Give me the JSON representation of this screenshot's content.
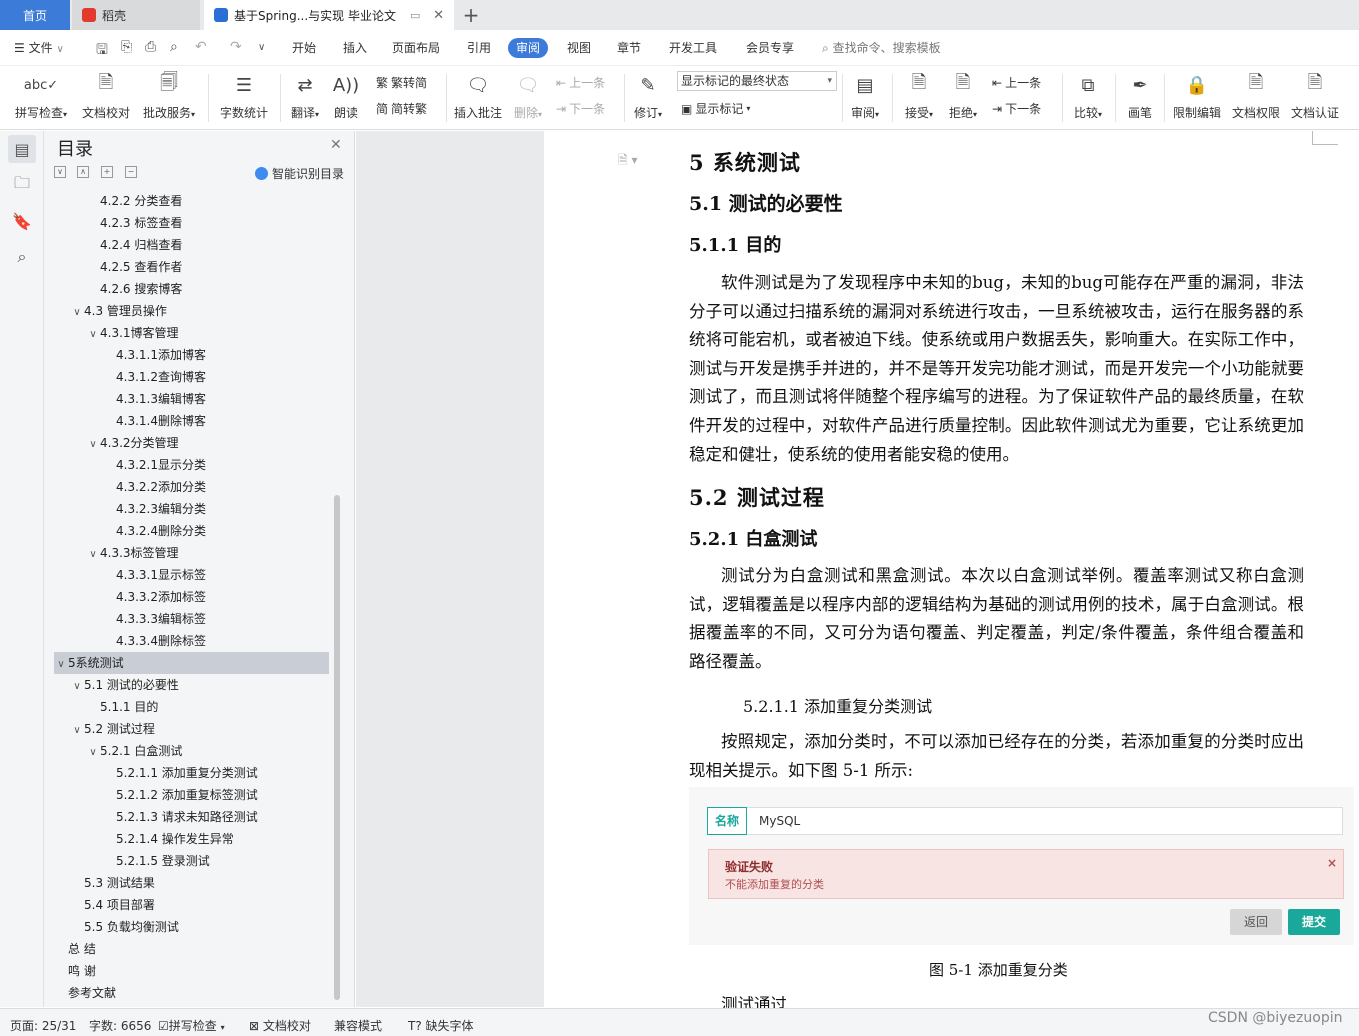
{
  "window": {
    "tabs": {
      "home": "首页",
      "daoke": "稻壳",
      "doc": "基于Spring...与实现 毕业论文"
    }
  },
  "menu": {
    "file": "文件",
    "items": [
      "开始",
      "插入",
      "页面布局",
      "引用",
      "审阅",
      "视图",
      "章节",
      "开发工具",
      "会员专享"
    ],
    "search": "查找命令、搜索模板"
  },
  "ribbon": {
    "spell": "拼写检查",
    "proof": "文档校对",
    "batch": "批改服务",
    "wordcount": "字数统计",
    "translate": "翻译",
    "read": "朗读",
    "trad": "繁转简",
    "simp": "简转繁",
    "insert_comment": "插入批注",
    "delete": "删除",
    "prev": "上一条",
    "next": "下一条",
    "revise": "修订",
    "markup_state": "显示标记的最终状态",
    "show_markup": "显示标记",
    "review": "审阅",
    "accept": "接受",
    "reject": "拒绝",
    "prev2": "上一条",
    "next2": "下一条",
    "compare": "比较",
    "pen": "画笔",
    "restrict": "限制编辑",
    "perm": "文档权限",
    "cert": "文档认证"
  },
  "toc": {
    "title": "目录",
    "smart": "智能识别目录",
    "items": [
      {
        "text": "4.2.2  分类查看",
        "level": 3,
        "caret": ""
      },
      {
        "text": "4.2.3  标签查看",
        "level": 3,
        "caret": ""
      },
      {
        "text": "4.2.4  归档查看",
        "level": 3,
        "caret": ""
      },
      {
        "text": "4.2.5  查看作者",
        "level": 3,
        "caret": ""
      },
      {
        "text": "4.2.6  搜索博客",
        "level": 3,
        "caret": ""
      },
      {
        "text": "4.3  管理员操作",
        "level": 2,
        "caret": "∨"
      },
      {
        "text": "4.3.1博客管理",
        "level": 3,
        "caret": "∨"
      },
      {
        "text": "4.3.1.1添加博客",
        "level": 4,
        "caret": ""
      },
      {
        "text": "4.3.1.2查询博客",
        "level": 4,
        "caret": ""
      },
      {
        "text": "4.3.1.3编辑博客",
        "level": 4,
        "caret": ""
      },
      {
        "text": "4.3.1.4删除博客",
        "level": 4,
        "caret": ""
      },
      {
        "text": "4.3.2分类管理",
        "level": 3,
        "caret": "∨"
      },
      {
        "text": "4.3.2.1显示分类",
        "level": 4,
        "caret": ""
      },
      {
        "text": "4.3.2.2添加分类",
        "level": 4,
        "caret": ""
      },
      {
        "text": "4.3.2.3编辑分类",
        "level": 4,
        "caret": ""
      },
      {
        "text": "4.3.2.4删除分类",
        "level": 4,
        "caret": ""
      },
      {
        "text": "4.3.3标签管理",
        "level": 3,
        "caret": "∨"
      },
      {
        "text": "4.3.3.1显示标签",
        "level": 4,
        "caret": ""
      },
      {
        "text": "4.3.3.2添加标签",
        "level": 4,
        "caret": ""
      },
      {
        "text": "4.3.3.3编辑标签",
        "level": 4,
        "caret": ""
      },
      {
        "text": "4.3.3.4删除标签",
        "level": 4,
        "caret": ""
      },
      {
        "text": "5系统测试",
        "level": 1,
        "caret": "∨",
        "selected": true
      },
      {
        "text": "5.1 测试的必要性",
        "level": 2,
        "caret": "∨"
      },
      {
        "text": "5.1.1  目的",
        "level": 3,
        "caret": ""
      },
      {
        "text": "5.2 测试过程",
        "level": 2,
        "caret": "∨"
      },
      {
        "text": "5.2.1  白盒测试",
        "level": 3,
        "caret": "∨"
      },
      {
        "text": "5.2.1.1  添加重复分类测试",
        "level": 4,
        "caret": ""
      },
      {
        "text": "5.2.1.2  添加重复标签测试",
        "level": 4,
        "caret": ""
      },
      {
        "text": "5.2.1.3  请求未知路径测试",
        "level": 4,
        "caret": ""
      },
      {
        "text": "5.2.1.4  操作发生异常",
        "level": 4,
        "caret": ""
      },
      {
        "text": "5.2.1.5  登录测试",
        "level": 4,
        "caret": ""
      },
      {
        "text": "5.3 测试结果",
        "level": 2,
        "caret": ""
      },
      {
        "text": "5.4 项目部署",
        "level": 2,
        "caret": ""
      },
      {
        "text": "5.5 负载均衡测试",
        "level": 2,
        "caret": ""
      },
      {
        "text": "总  结",
        "level": 1,
        "caret": ""
      },
      {
        "text": "鸣  谢",
        "level": 1,
        "caret": ""
      },
      {
        "text": "参考文献",
        "level": 1,
        "caret": ""
      }
    ]
  },
  "doc": {
    "h_5": "5    系统测试",
    "h_51": "5.1 测试的必要性",
    "h_511": "5.1.1  目的",
    "p1": "软件测试是为了发现程序中未知的bug，未知的bug可能存在严重的漏洞，非法分子可以通过扫描系统的漏洞对系统进行攻击，一旦系统被攻击，运行在服务器的系统将可能宕机，或者被迫下线。使系统或用户数据丢失，影响重大。在实际工作中，测试与开发是携手并进的，并不是等开发完功能才测试，而是开发完一个小功能就要测试了，而且测试将伴随整个程序编写的进程。为了保证软件产品的最终质量，在软件开发的过程中，对软件产品进行质量控制。因此软件测试尤为重要，它让系统更加稳定和健壮，使系统的使用者能安稳的使用。",
    "h_52": "5.2 测试过程",
    "h_521": "5.2.1  白盒测试",
    "p2": "测试分为白盒测试和黑盒测试。本次以白盒测试举例。覆盖率测试又称白盒测试，逻辑覆盖是以程序内部的逻辑结构为基础的测试用例的技术，属于白盒测试。根据覆盖率的不同，又可分为语句覆盖、判定覆盖，判定/条件覆盖，条件组合覆盖和路径覆盖。",
    "h_5211": "5.2.1.1  添加重复分类测试",
    "p3": "按照规定，添加分类时，不可以添加已经存在的分类，若添加重复的分类时应出现相关提示。如下图 5-1 所示:",
    "fig": {
      "name_label": "名称",
      "name_value": "MySQL",
      "alert_title": "验证失败",
      "alert_msg": "不能添加重复的分类",
      "alert_close": "×",
      "back": "返回",
      "submit": "提交"
    },
    "caption": "图 5-1 添加重复分类",
    "p4": "测试通过"
  },
  "status": {
    "page": "页面: 25/31",
    "words": "字数: 6656",
    "spell": "拼写检查",
    "proof": "文档校对",
    "compat": "兼容模式",
    "missing_font": "缺失字体"
  },
  "watermark": "CSDN @biyezuopin",
  "colors": {
    "accent": "#3d7bd8",
    "teal": "#1aa89a",
    "alert_bg": "#f9e4e4"
  }
}
